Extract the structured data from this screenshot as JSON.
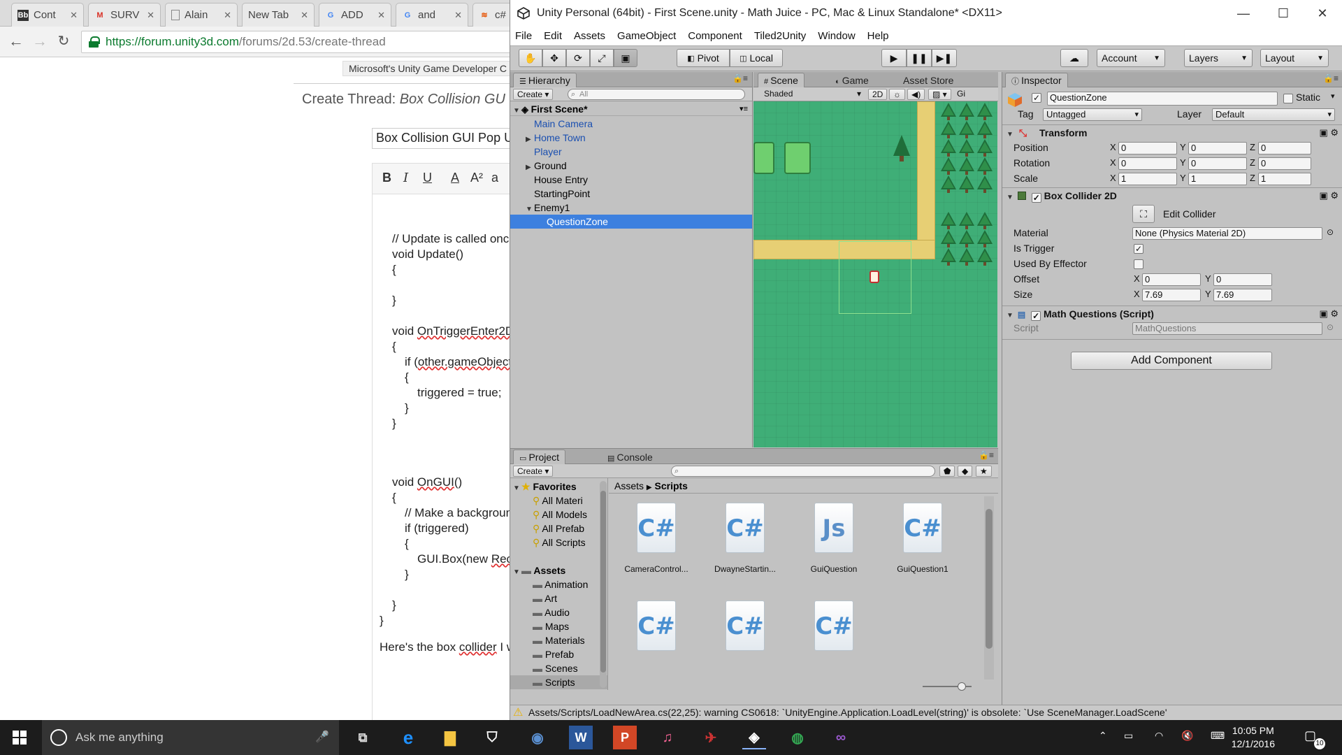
{
  "browser": {
    "tabs": [
      {
        "icon": "Bb",
        "label": "Cont"
      },
      {
        "icon": "M",
        "label": "SURV"
      },
      {
        "icon": "",
        "label": "Alain"
      },
      {
        "icon": "",
        "label": "New Tab"
      },
      {
        "icon": "G",
        "label": "ADD"
      },
      {
        "icon": "G",
        "label": "and"
      },
      {
        "icon": "",
        "label": "c#"
      }
    ],
    "url_host": "https://forum.unity3d.com",
    "url_path": "/forums/2d.53/create-thread",
    "breadcrumb": "Microsoft's Unity Game Developer C",
    "create_thread_prefix": "Create Thread: ",
    "create_thread_title": "Box Collision GU",
    "title_input_value": "Box Collision GUI Pop U",
    "editor_buttons": [
      "B",
      "I",
      "U",
      "A",
      "A²",
      "a"
    ],
    "code_lines": [
      {
        "indent": 0,
        "text": "// Update is called once"
      },
      {
        "indent": 0,
        "text": "void Update()"
      },
      {
        "indent": 0,
        "text": "{"
      },
      {
        "indent": 0,
        "text": "}"
      },
      {
        "indent": 0,
        "pre": "void ",
        "sq": "OnTriggerEnter2D"
      },
      {
        "indent": 0,
        "text": "{"
      },
      {
        "indent": 1,
        "pre": "if (",
        "sq": "other.gameObject"
      },
      {
        "indent": 1,
        "text": "{"
      },
      {
        "indent": 2,
        "text": "triggered = true;"
      },
      {
        "indent": 1,
        "text": "}"
      },
      {
        "indent": 0,
        "text": "}"
      },
      {
        "indent": 0,
        "pre": "void ",
        "sq": "OnGUI",
        "post": "()"
      },
      {
        "indent": 0,
        "text": "{"
      },
      {
        "indent": 1,
        "text": "// Make a backgroun"
      },
      {
        "indent": 1,
        "text": "if (triggered)"
      },
      {
        "indent": 1,
        "text": "{"
      },
      {
        "indent": 2,
        "pre": "GUI.Box(new ",
        "sq": "Rec"
      },
      {
        "indent": 1,
        "text": "}"
      },
      {
        "indent": 0,
        "text": "}"
      },
      {
        "indent": -1,
        "text": "}"
      }
    ],
    "footer_text_pre": "Here's the box ",
    "footer_text_sq": "collider",
    "footer_text_post": " I w"
  },
  "unity": {
    "title": "Unity Personal (64bit) - First Scene.unity - Math Juice - PC, Mac & Linux Standalone* <DX11>",
    "menu": [
      "File",
      "Edit",
      "Assets",
      "GameObject",
      "Component",
      "Tiled2Unity",
      "Window",
      "Help"
    ],
    "toolbar": {
      "pivot": "Pivot",
      "local": "Local",
      "account": "Account",
      "layers": "Layers",
      "layout": "Layout"
    },
    "hierarchy": {
      "tab": "Hierarchy",
      "create": "Create",
      "search_placeholder": "All",
      "scene_name": "First Scene*",
      "items": [
        {
          "label": "Main Camera",
          "blue": true,
          "arrow": "",
          "level": 1
        },
        {
          "label": "Home Town",
          "blue": true,
          "arrow": "▶",
          "level": 1
        },
        {
          "label": "Player",
          "blue": true,
          "arrow": "",
          "level": 1
        },
        {
          "label": "Ground",
          "blue": false,
          "arrow": "▶",
          "level": 1
        },
        {
          "label": "House Entry",
          "blue": false,
          "arrow": "",
          "level": 1
        },
        {
          "label": "StartingPoint",
          "blue": false,
          "arrow": "",
          "level": 1
        },
        {
          "label": "Enemy1",
          "blue": false,
          "arrow": "▼",
          "level": 1
        },
        {
          "label": "QuestionZone",
          "blue": false,
          "arrow": "",
          "level": 2,
          "selected": true
        }
      ]
    },
    "scene": {
      "tab_scene": "Scene",
      "tab_game": "Game",
      "tab_asset_store": "Asset Store",
      "shading": "Shaded",
      "mode_2d": "2D",
      "gizmos": "Gi"
    },
    "inspector": {
      "tab": "Inspector",
      "object_name": "QuestionZone",
      "static_label": "Static",
      "tag_label": "Tag",
      "tag_value": "Untagged",
      "layer_label": "Layer",
      "layer_value": "Default",
      "transform": {
        "title": "Transform",
        "rows": [
          {
            "label": "Position",
            "x": "0",
            "y": "0",
            "z": "0"
          },
          {
            "label": "Rotation",
            "x": "0",
            "y": "0",
            "z": "0"
          },
          {
            "label": "Scale",
            "x": "1",
            "y": "1",
            "z": "1"
          }
        ]
      },
      "box_collider": {
        "title": "Box Collider 2D",
        "edit_collider": "Edit Collider",
        "material_label": "Material",
        "material_value": "None (Physics Material 2D)",
        "is_trigger_label": "Is Trigger",
        "is_trigger": true,
        "used_by_effector_label": "Used By Effector",
        "used_by_effector": false,
        "offset_label": "Offset",
        "offset_x": "0",
        "offset_y": "0",
        "size_label": "Size",
        "size_x": "7.69",
        "size_y": "7.69"
      },
      "math_questions": {
        "title": "Math Questions (Script)",
        "script_label": "Script",
        "script_value": "MathQuestions"
      },
      "add_component": "Add Component"
    },
    "project": {
      "tab_project": "Project",
      "tab_console": "Console",
      "create": "Create",
      "favorites_label": "Favorites",
      "favorites": [
        "All Materi",
        "All Models",
        "All Prefab",
        "All Scripts"
      ],
      "assets_label": "Assets",
      "folders": [
        "Animation",
        "Art",
        "Audio",
        "Maps",
        "Materials",
        "Prefab",
        "Scenes",
        "Scripts"
      ],
      "breadcrumb_root": "Assets",
      "breadcrumb_current": "Scripts",
      "files": [
        {
          "type": "C#",
          "name": "CameraControl..."
        },
        {
          "type": "C#",
          "name": "DwayneStartin..."
        },
        {
          "type": "Js",
          "name": "GuiQuestion"
        },
        {
          "type": "C#",
          "name": "GuiQuestion1"
        },
        {
          "type": "C#",
          "name": ""
        },
        {
          "type": "C#",
          "name": ""
        },
        {
          "type": "C#",
          "name": ""
        }
      ]
    },
    "status": "Assets/Scripts/LoadNewArea.cs(22,25): warning CS0618: `UnityEngine.Application.LoadLevel(string)' is obsolete: `Use SceneManager.LoadScene'"
  },
  "taskbar": {
    "search_placeholder": "Ask me anything",
    "time": "10:05 PM",
    "date": "12/1/2016",
    "notifications": "10"
  },
  "colors": {
    "unity_bg": "#c2c2c2",
    "selection": "#3d80df",
    "grass": "#3fae77",
    "path": "#e7cf74",
    "taskbar": "#1c1c1c"
  }
}
